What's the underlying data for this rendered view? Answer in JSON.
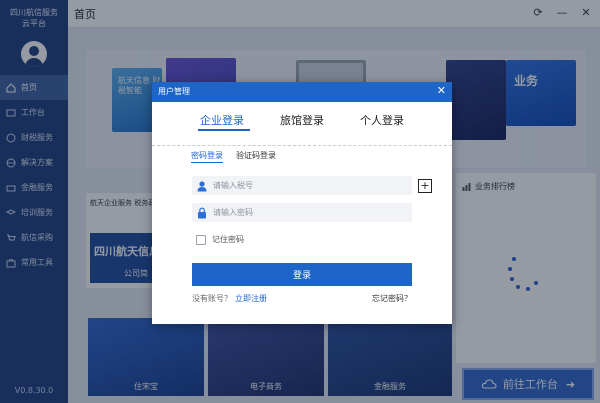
{
  "sidebar": {
    "title_line1": "四川航信服务",
    "title_line2": "云平台",
    "items": [
      {
        "label": "首页",
        "icon": "home-icon"
      },
      {
        "label": "工作台",
        "icon": "workbench-icon"
      },
      {
        "label": "财税服务",
        "icon": "tax-icon"
      },
      {
        "label": "解决方案",
        "icon": "solution-icon"
      },
      {
        "label": "金融服务",
        "icon": "finance-icon"
      },
      {
        "label": "培训服务",
        "icon": "training-icon"
      },
      {
        "label": "航信采购",
        "icon": "cart-icon"
      },
      {
        "label": "常用工具",
        "icon": "toolbox-icon"
      }
    ],
    "version": "V0.8.30.0"
  },
  "topbar": {
    "title": "首页",
    "refresh_glyph": "⟳",
    "minimize_glyph": "—",
    "close_glyph": "✕"
  },
  "main": {
    "banner": {
      "card1_text": "航天信息 财税智能",
      "card5_text": "业务"
    },
    "news": {
      "header": "航天企业服务 税务政策新",
      "image_title": "四川航天信息有",
      "image_caption": "公司简"
    },
    "rank": {
      "title": "业务排行榜"
    },
    "tiles": [
      {
        "label": "住宋宝"
      },
      {
        "label": "电子商务"
      },
      {
        "label": "金融服务"
      }
    ],
    "goto_button": "前往工作台",
    "goto_arrow": "➜"
  },
  "dialog": {
    "title": "用户管理",
    "close_glyph": "✕",
    "main_tabs": [
      {
        "label": "企业登录",
        "active": true
      },
      {
        "label": "旅馆登录",
        "active": false
      },
      {
        "label": "个人登录",
        "active": false
      }
    ],
    "sub_tabs": [
      {
        "label": "密码登录",
        "active": true
      },
      {
        "label": "验证码登录",
        "active": false
      }
    ],
    "tax_id_placeholder": "请输入税号",
    "tax_id_value": "",
    "password_placeholder": "请输入密码",
    "password_value": "",
    "plus_glyph": "+",
    "remember_label": "记住密码",
    "remember_checked": false,
    "login_button": "登录",
    "no_account_text": "没有账号？",
    "register_link": "立即注册",
    "forgot_link": "忘记密码？"
  },
  "colors": {
    "sidebar_bg": "#1c3d7e",
    "sidebar_active": "#3b5fa3",
    "primary": "#1e65c8",
    "input_bg": "#f1f3f6"
  }
}
